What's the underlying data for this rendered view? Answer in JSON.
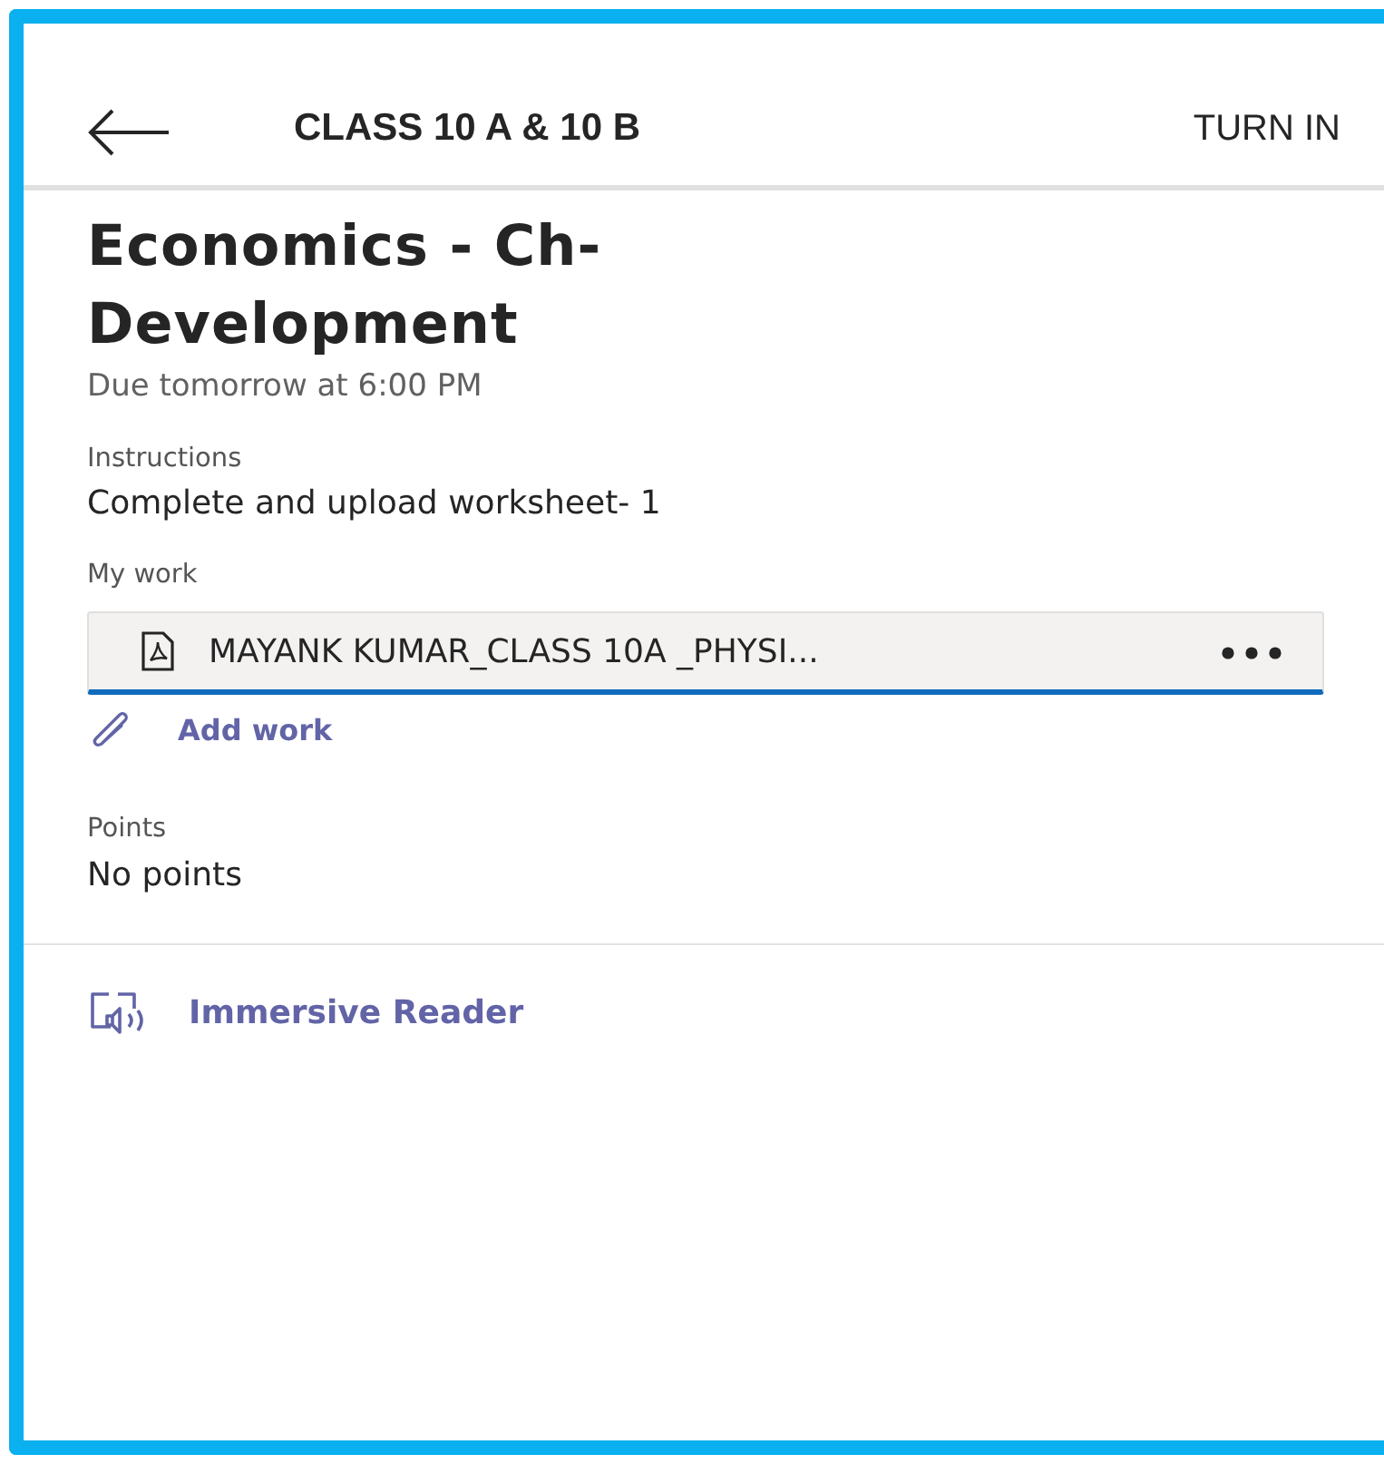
{
  "header": {
    "title": "CLASS 10 A & 10 B",
    "action": "TURN IN"
  },
  "assignment": {
    "title": "Economics - Ch-Development",
    "due": "Due tomorrow at 6:00 PM"
  },
  "instructions": {
    "label": "Instructions",
    "text": "Complete and upload worksheet- 1"
  },
  "my_work": {
    "label": "My work",
    "file": "MAYANK KUMAR_CLASS 10A _PHYSI...",
    "add": "Add work"
  },
  "points": {
    "label": "Points",
    "value": "No points"
  },
  "reader": {
    "label": "Immersive Reader"
  }
}
